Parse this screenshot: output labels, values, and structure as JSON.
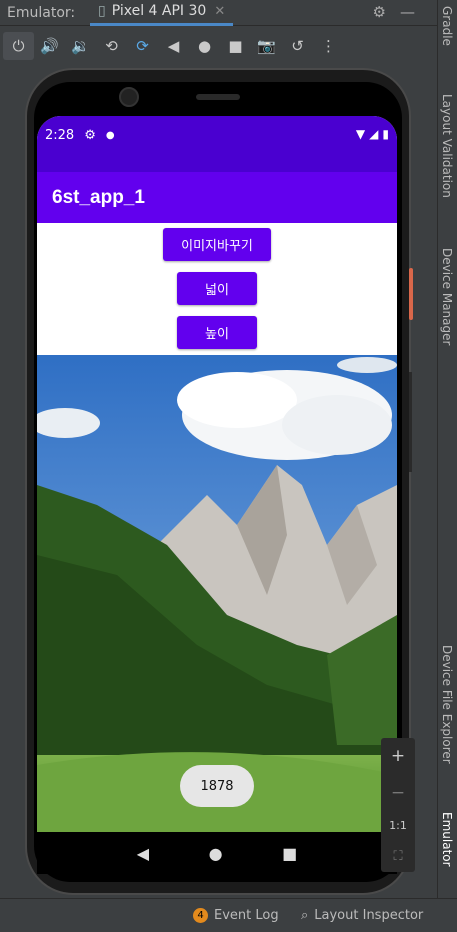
{
  "ide": {
    "emulator_label": "Emulator:",
    "device_tab": "Pixel 4 API 30",
    "right_tabs": [
      "Gradle",
      "Layout Validation",
      "Device Manager",
      "Device File Explorer",
      "Emulator"
    ],
    "bottom": {
      "event_log_count": "4",
      "event_log": "Event Log",
      "layout_inspector": "Layout Inspector"
    },
    "zoom": {
      "plus": "+",
      "minus": "−",
      "one_to_one": "1:1"
    }
  },
  "phone": {
    "status_time": "2:28",
    "app_title": "6st_app_1",
    "buttons": {
      "change_image": "이미지바꾸기",
      "width": "넓이",
      "height": "높이"
    },
    "toast": "1878"
  },
  "colors": {
    "primary": "#6200ee",
    "primary_dark": "#4a00d0"
  }
}
